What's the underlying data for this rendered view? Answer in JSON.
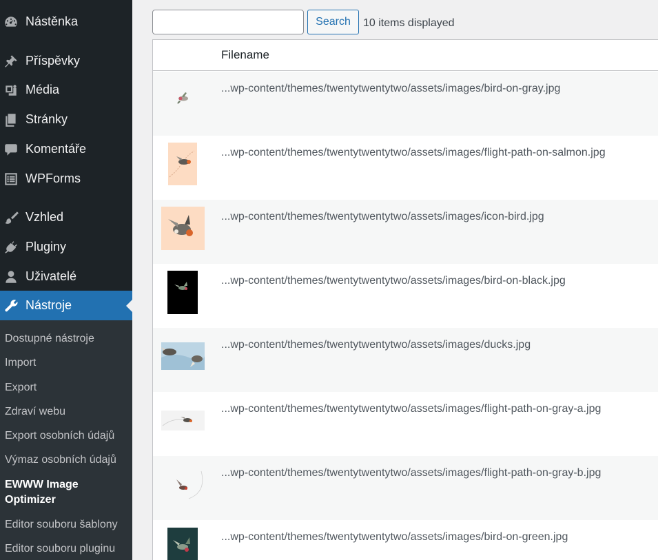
{
  "sidebar": {
    "items": [
      {
        "label": "Nástěnka",
        "icon": "dashboard-icon"
      },
      {
        "label": "Příspěvky",
        "icon": "pin-icon"
      },
      {
        "label": "Média",
        "icon": "media-icon"
      },
      {
        "label": "Stránky",
        "icon": "pages-icon"
      },
      {
        "label": "Komentáře",
        "icon": "comments-icon"
      },
      {
        "label": "WPForms",
        "icon": "forms-icon"
      },
      {
        "label": "Vzhled",
        "icon": "brush-icon"
      },
      {
        "label": "Pluginy",
        "icon": "plugin-icon"
      },
      {
        "label": "Uživatelé",
        "icon": "user-icon"
      },
      {
        "label": "Nástroje",
        "icon": "wrench-icon"
      }
    ],
    "submenu": [
      {
        "label": "Dostupné nástroje"
      },
      {
        "label": "Import"
      },
      {
        "label": "Export"
      },
      {
        "label": "Zdraví webu"
      },
      {
        "label": "Export osobních údajů"
      },
      {
        "label": "Výmaz osobních údajů"
      },
      {
        "label": "EWWW Image Optimizer"
      },
      {
        "label": "Editor souboru šablony"
      },
      {
        "label": "Editor souboru pluginu"
      }
    ]
  },
  "search": {
    "placeholder": "",
    "value": "",
    "button_label": "Search"
  },
  "count_text": "10 items displayed",
  "table": {
    "header_filename": "Filename",
    "rows": [
      {
        "filename": "...wp-content/themes/twentytwentytwo/assets/images/bird-on-gray.jpg"
      },
      {
        "filename": "...wp-content/themes/twentytwentytwo/assets/images/flight-path-on-salmon.jpg"
      },
      {
        "filename": "...wp-content/themes/twentytwentytwo/assets/images/icon-bird.jpg"
      },
      {
        "filename": "...wp-content/themes/twentytwentytwo/assets/images/bird-on-black.jpg"
      },
      {
        "filename": "...wp-content/themes/twentytwentytwo/assets/images/ducks.jpg"
      },
      {
        "filename": "...wp-content/themes/twentytwentytwo/assets/images/flight-path-on-gray-a.jpg"
      },
      {
        "filename": "...wp-content/themes/twentytwentytwo/assets/images/flight-path-on-gray-b.jpg"
      },
      {
        "filename": "...wp-content/themes/twentytwentytwo/assets/images/bird-on-green.jpg"
      }
    ]
  },
  "colors": {
    "sidebar": "#1d2327",
    "submenu": "#2c3338",
    "accent": "#2271b1",
    "salmon": "#fddcc3",
    "green": "#1e3d3e"
  }
}
